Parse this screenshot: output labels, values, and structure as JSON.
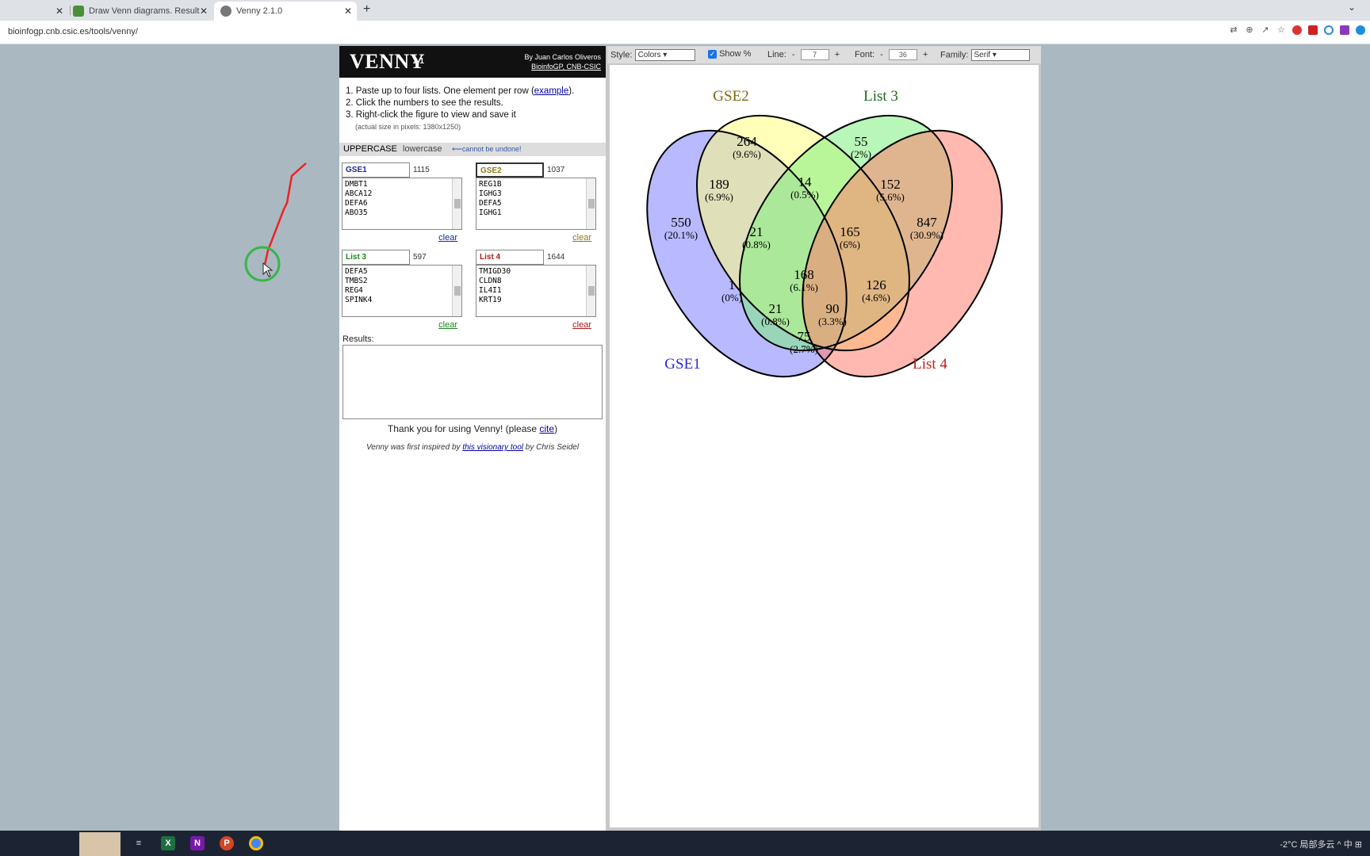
{
  "browser": {
    "tabs": [
      {
        "title": "",
        "active": false
      },
      {
        "title": "Draw Venn diagrams. Result",
        "active": false
      },
      {
        "title": "Venny 2.1.0",
        "active": true
      }
    ],
    "new_tab": "+",
    "menu": "⌄",
    "url": "bioinfogp.cnb.csic.es/tools/venny/"
  },
  "venny": {
    "logo": "VENNY",
    "version": "2.1",
    "by_line": "By Juan Carlos Oliveros",
    "by_links": "BioinfoGP, CNB-CSIC",
    "instructions": [
      {
        "prefix": "1. Paste up to four lists. One element per row (",
        "link": "example",
        "suffix": ")."
      },
      {
        "text": "2. Click the numbers to see the results."
      },
      {
        "text": "3. Right-click the figure to view and save it"
      }
    ],
    "actual_size": "(actual size in pixels: 1380x1250)",
    "case": {
      "upper": "UPPERCASE",
      "lower": "lowercase",
      "warning": "⟵cannot be undone!"
    },
    "lists": [
      {
        "name": "GSE1",
        "count": "1115",
        "items": [
          "DMBT1",
          "ABCA12",
          "DEFA6",
          "ABO35"
        ],
        "clear": "clear",
        "color": "#1d2a8a"
      },
      {
        "name": "GSE2",
        "count": "1037",
        "items": [
          "REG1B",
          "IGHG3",
          "DEFA5",
          "IGHG1"
        ],
        "clear": "clear",
        "color": "#8a7a1a"
      },
      {
        "name": "List 3",
        "count": "597",
        "items": [
          "DEFA5",
          "TMBS2",
          "REG4",
          "SPINK4"
        ],
        "clear": "clear",
        "color": "#1a8a1a"
      },
      {
        "name": "List 4",
        "count": "1644",
        "items": [
          "TMIGD30",
          "CLDN8",
          "IL4I1",
          "KRT19"
        ],
        "clear": "clear",
        "color": "#b01a1a"
      }
    ],
    "results_label": "Results:",
    "thanks": {
      "prefix": "Thank you for using Venny!  (please ",
      "link": "cite",
      "suffix": ")"
    },
    "inspired": {
      "prefix": "Venny was first inspired by ",
      "link": "this visionary tool",
      "suffix": " by Chris Seidel"
    }
  },
  "toolbar": {
    "style_label": "Style:",
    "style_value": "Colors",
    "show_pct_label": "Show %",
    "line_label": "Line:",
    "line_value": "7",
    "font_label": "Font:",
    "font_value": "36",
    "family_label": "Family:",
    "family_value": "Serif",
    "minus": "-",
    "plus": "+"
  },
  "diagram": {
    "set_labels": [
      {
        "text": "GSE2",
        "color": "#7a6a10"
      },
      {
        "text": "List 3",
        "color": "#1a6a1a"
      },
      {
        "text": "GSE1",
        "color": "#2a2acf"
      },
      {
        "text": "List 4",
        "color": "#c0201a"
      }
    ],
    "set_colors": [
      "#8080ff",
      "#ffff80",
      "#80ee80",
      "#ff8070"
    ],
    "regions": [
      {
        "count": "264",
        "pct": "(9.6%)"
      },
      {
        "count": "55",
        "pct": "(2%)"
      },
      {
        "count": "189",
        "pct": "(6.9%)"
      },
      {
        "count": "14",
        "pct": "(0.5%)"
      },
      {
        "count": "152",
        "pct": "(5.6%)"
      },
      {
        "count": "550",
        "pct": "(20.1%)"
      },
      {
        "count": "847",
        "pct": "(30.9%)"
      },
      {
        "count": "21",
        "pct": "(0.8%)"
      },
      {
        "count": "165",
        "pct": "(6%)"
      },
      {
        "count": "168",
        "pct": "(6.1%)"
      },
      {
        "count": "1",
        "pct": "(0%)"
      },
      {
        "count": "126",
        "pct": "(4.6%)"
      },
      {
        "count": "21",
        "pct": "(0.8%)"
      },
      {
        "count": "90",
        "pct": "(3.3%)"
      },
      {
        "count": "75",
        "pct": "(2.7%)"
      }
    ]
  },
  "taskbar": {
    "apps": [
      "explorer",
      "excel",
      "onenote",
      "powerpoint",
      "chrome"
    ],
    "tray": "-2°C 局部多云   ^  中  ⊞"
  }
}
